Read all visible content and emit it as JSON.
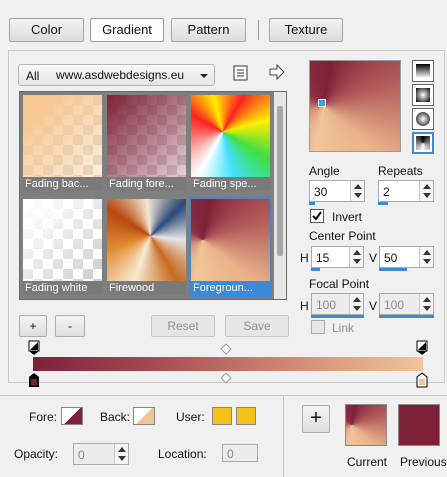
{
  "tabs": [
    {
      "label": "Color",
      "active": false
    },
    {
      "label": "Gradient",
      "active": true
    },
    {
      "label": "Pattern",
      "active": false
    },
    {
      "label": "Texture",
      "active": false
    }
  ],
  "library": {
    "selected_all": "All",
    "source": "www.asdwebdesigns.eu"
  },
  "gallery": [
    {
      "caption": "Fading bac...",
      "selected": false
    },
    {
      "caption": "Fading fore...",
      "selected": false
    },
    {
      "caption": "Fading spe...",
      "selected": false
    },
    {
      "caption": "Fading white",
      "selected": false
    },
    {
      "caption": "Firewood",
      "selected": false
    },
    {
      "caption": "Foregroun...",
      "selected": true
    }
  ],
  "buttons": {
    "add": "+",
    "remove": "-",
    "reset": "Reset",
    "save": "Save"
  },
  "settings": {
    "angle_label": "Angle",
    "angle_value": "30",
    "repeats_label": "Repeats",
    "repeats_value": "2",
    "invert_label": "Invert",
    "invert_checked": true,
    "center_label": "Center Point",
    "center_h_label": "H",
    "center_h": "15",
    "center_v_label": "V",
    "center_v": "50",
    "focal_label": "Focal Point",
    "focal_h_label": "H",
    "focal_h": "100",
    "focal_v_label": "V",
    "focal_v": "100",
    "link_label": "Link"
  },
  "bottom": {
    "fore_label": "Fore:",
    "back_label": "Back:",
    "user_label": "User:",
    "opacity_label": "Opacity:",
    "opacity_value": "0",
    "location_label": "Location:",
    "location_value": "0",
    "add_symbol": "+",
    "current_label": "Current",
    "previous_label": "Previous"
  },
  "colors": {
    "foreground": "#7d2138",
    "background": "#f0c697",
    "user": "#f2c21a",
    "accent": "#3b8ad8"
  }
}
